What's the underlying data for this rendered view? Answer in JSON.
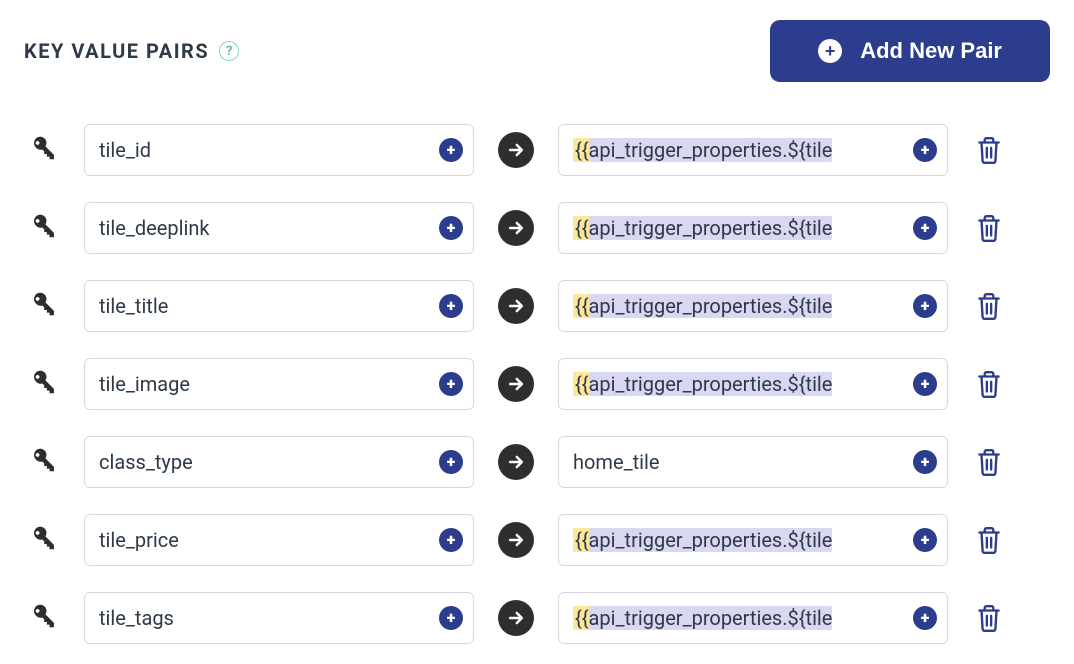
{
  "section": {
    "title": "KEY VALUE PAIRS",
    "help_tooltip": "?",
    "add_button_label": "Add New Pair"
  },
  "pairs": [
    {
      "key": "tile_id",
      "value": "{{api_trigger_properties.${tile",
      "value_is_template": true
    },
    {
      "key": "tile_deeplink",
      "value": "{{api_trigger_properties.${tile",
      "value_is_template": true
    },
    {
      "key": "tile_title",
      "value": "{{api_trigger_properties.${tile",
      "value_is_template": true
    },
    {
      "key": "tile_image",
      "value": "{{api_trigger_properties.${tile",
      "value_is_template": true
    },
    {
      "key": "class_type",
      "value": "home_tile",
      "value_is_template": false
    },
    {
      "key": "tile_price",
      "value": "{{api_trigger_properties.${tile",
      "value_is_template": true
    },
    {
      "key": "tile_tags",
      "value": "{{api_trigger_properties.${tile",
      "value_is_template": true
    }
  ]
}
